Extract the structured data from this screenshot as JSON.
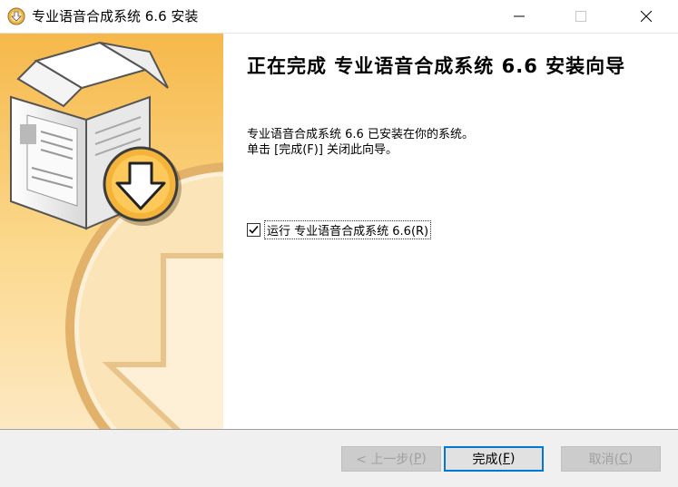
{
  "window": {
    "title": "专业语音合成系统 6.6 安装",
    "icons": {
      "app": "installer-disc-icon",
      "minimize": "minimize-icon",
      "maximize": "maximize-icon",
      "close": "close-icon"
    }
  },
  "banner": {
    "image": "installer-box-download-illustration",
    "colors": {
      "main": "#f6b84a",
      "light": "#fbe1a8",
      "pale": "#fdf0d6"
    }
  },
  "content": {
    "heading": "正在完成 专业语音合成系统 6.6 安装向导",
    "line1": "专业语音合成系统 6.6 已安装在你的系统。",
    "line2": "单击 [完成(F)] 关闭此向导。",
    "run_option": {
      "checked": true,
      "label": "运行 专业语音合成系统 6.6(R)"
    }
  },
  "buttons": {
    "back": {
      "prefix": "< 上一步(",
      "key": "P",
      "suffix": ")",
      "enabled": false
    },
    "finish": {
      "prefix": "完成(",
      "key": "F",
      "suffix": ")",
      "default": true
    },
    "cancel": {
      "prefix": "取消(",
      "key": "C",
      "suffix": ")",
      "enabled": false
    }
  },
  "colors": {
    "accent": "#0078d7",
    "footer_bg": "#f0f0f0",
    "disabled_text": "#a0a0a0"
  }
}
